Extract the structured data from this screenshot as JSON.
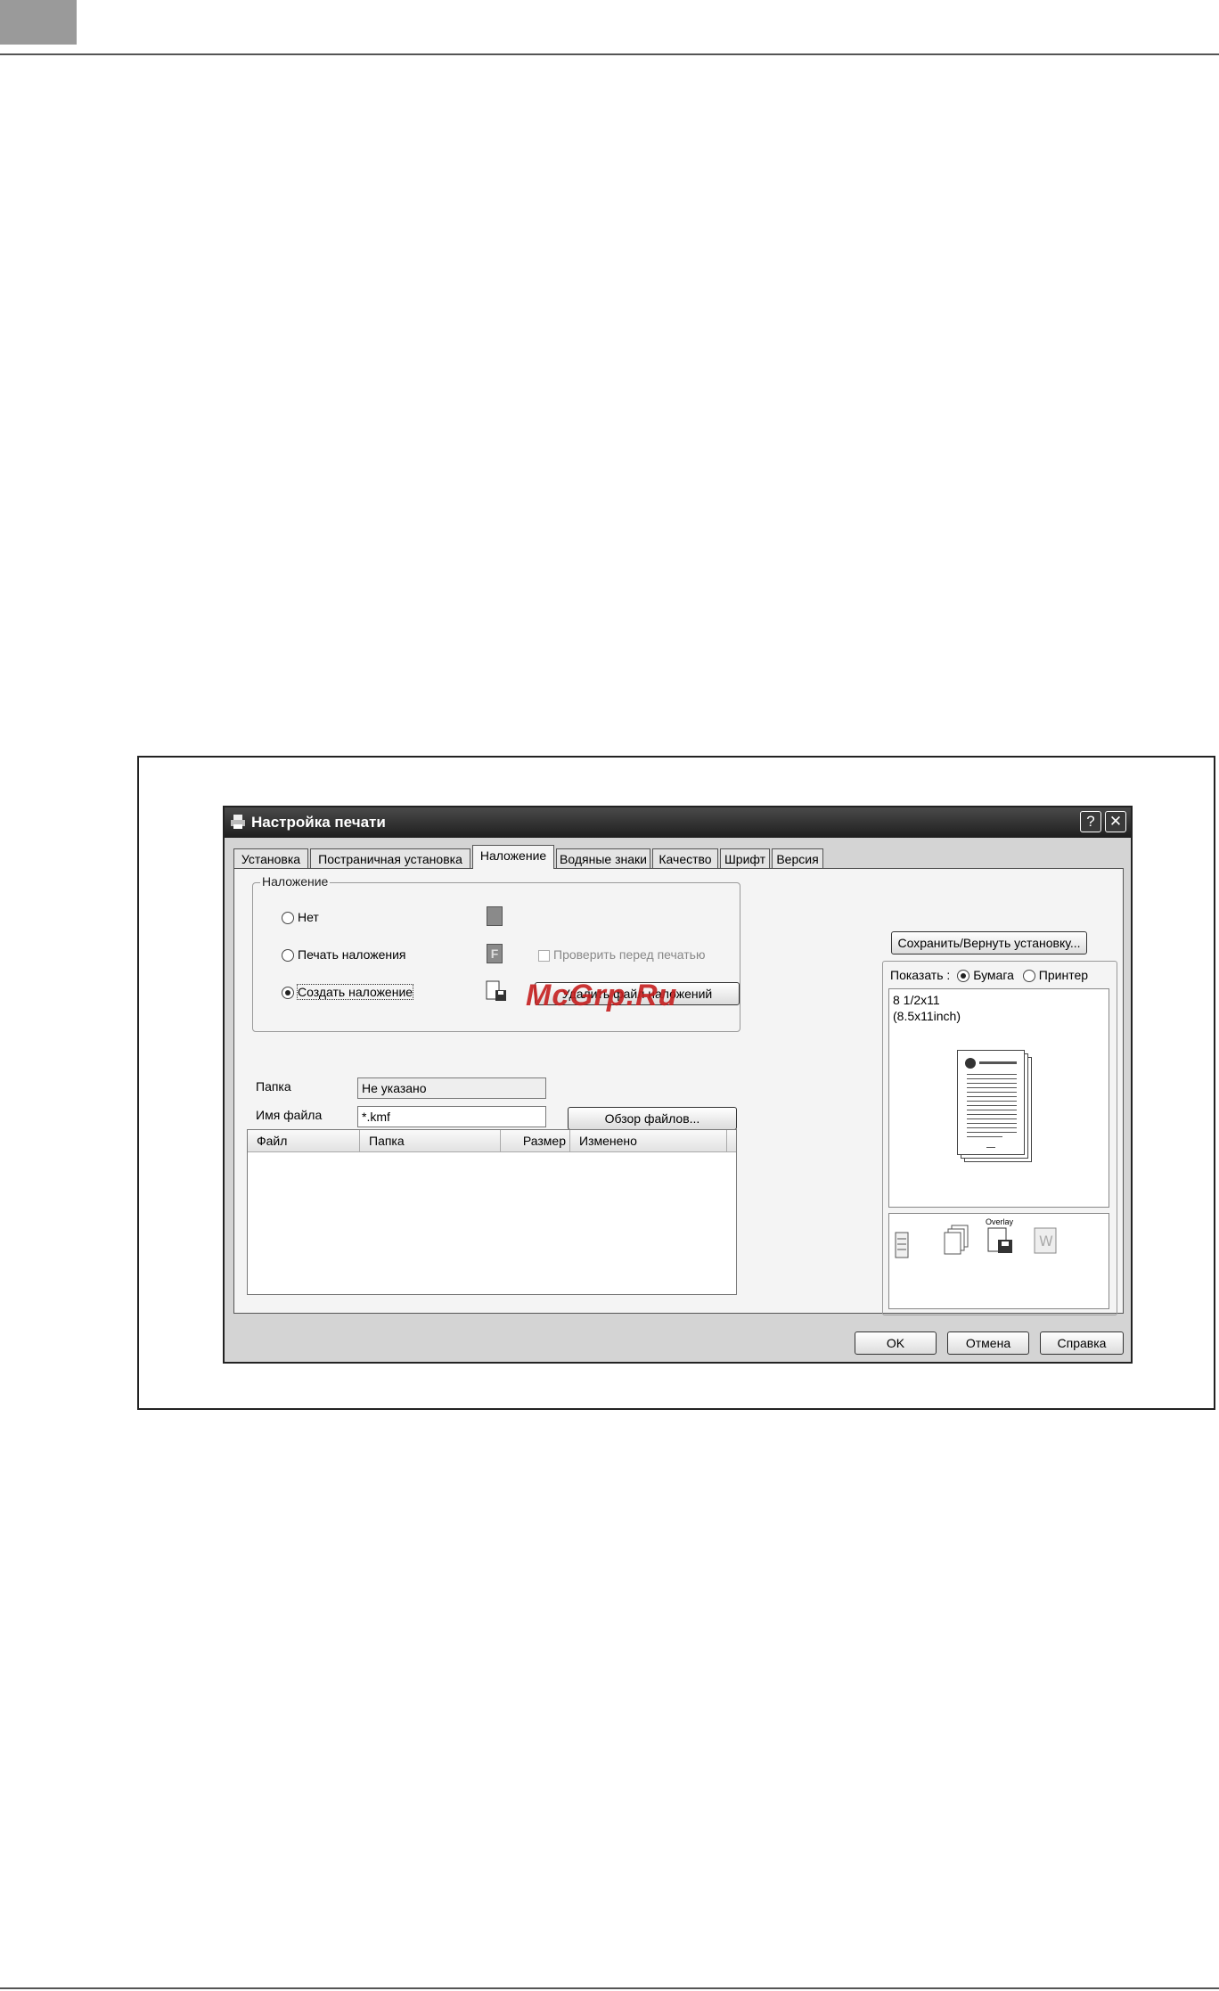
{
  "dialog": {
    "title": "Настройка печати",
    "help_button": "?",
    "close_button": "✕"
  },
  "tabs": [
    "Установка",
    "Постраничная установка",
    "Наложение",
    "Водяные знаки",
    "Качество",
    "Шрифт",
    "Версия"
  ],
  "active_tab": "Наложение",
  "overlay_group": {
    "legend": "Наложение",
    "options": {
      "none": "Нет",
      "print": "Печать наложения",
      "create": "Создать наложение"
    },
    "selected": "Создать наложение",
    "verify_checkbox": "Проверить перед печатью",
    "delete_button": "Удалить файл наложений"
  },
  "folder": {
    "label": "Папка",
    "value": "Не указано"
  },
  "filename": {
    "label": "Имя файла",
    "value": "*.kmf"
  },
  "browse_button": "Обзор файлов...",
  "file_list": {
    "columns": [
      "Файл",
      "Папка",
      "Размер",
      "Изменено"
    ]
  },
  "right_panel": {
    "save_button": "Сохранить/Вернуть установку...",
    "show_label": "Показать :",
    "show_paper": "Бумага",
    "show_printer": "Принтер",
    "paper_name": "8 1/2x11",
    "paper_size": "(8.5x11inch)",
    "overlay_caption": "Overlay"
  },
  "footer": {
    "ok": "OK",
    "cancel": "Отмена",
    "help": "Справка"
  },
  "watermark": "McGrp.Ru",
  "icons": [
    "printer-icon",
    "help-icon",
    "close-icon",
    "overlay-none-icon",
    "overlay-print-icon",
    "overlay-create-icon",
    "status-printer-icon",
    "status-pages-icon",
    "status-overlay-icon",
    "status-watermark-icon"
  ]
}
